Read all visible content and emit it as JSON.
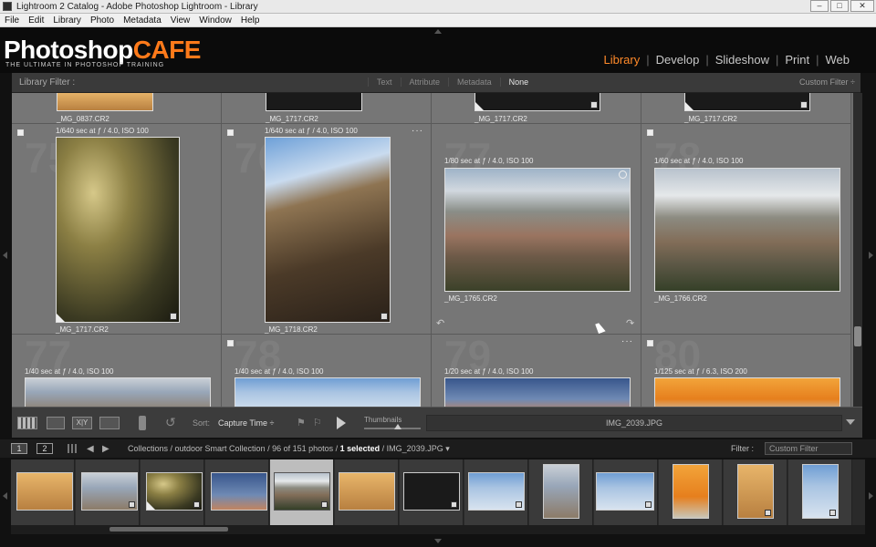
{
  "window": {
    "title": "Lightroom 2 Catalog - Adobe Photoshop Lightroom - Library",
    "controls": [
      "–",
      "□",
      "✕"
    ]
  },
  "menu": [
    "File",
    "Edit",
    "Library",
    "Photo",
    "Metadata",
    "View",
    "Window",
    "Help"
  ],
  "identity": {
    "logo_main": "Photoshop",
    "logo_accent": "CAFE",
    "tagline": "THE ULTIMATE IN PHOTOSHOP TRAINING",
    "accent_color": "#ff7a1a"
  },
  "modules": [
    {
      "label": "Library",
      "active": true
    },
    {
      "label": "Develop",
      "active": false
    },
    {
      "label": "Slideshow",
      "active": false
    },
    {
      "label": "Print",
      "active": false
    },
    {
      "label": "Web",
      "active": false
    }
  ],
  "library_filter": {
    "label": "Library Filter :",
    "options": [
      "Text",
      "Attribute",
      "Metadata",
      "None"
    ],
    "selected": "None",
    "preset": "Custom Filter ÷"
  },
  "grid": {
    "top_row": [
      {
        "filename": "_MG_0837.CR2"
      },
      {
        "filename": "_MG_1717.CR2"
      },
      {
        "filename": "_MG_1717.CR2"
      },
      {
        "filename": "_MG_1717.CR2"
      }
    ],
    "middle_row": [
      {
        "number": "75",
        "meta": "1/640 sec at ƒ / 4.0, ISO 100",
        "filename": "_MG_1717.CR2"
      },
      {
        "number": "76",
        "meta": "1/640 sec at ƒ / 4.0, ISO 100",
        "filename": "_MG_1718.CR2",
        "dots": "···"
      },
      {
        "number": "77",
        "meta": "1/80 sec at ƒ / 4.0, ISO 100",
        "filename": "_MG_1765.CR2"
      },
      {
        "number": "78",
        "meta": "1/60 sec at ƒ / 4.0, ISO 100",
        "filename": "_MG_1766.CR2"
      }
    ],
    "bottom_row": [
      {
        "number": "77",
        "meta": "1/40 sec at ƒ / 4.0, ISO 100"
      },
      {
        "number": "78",
        "meta": "1/40 sec at ƒ / 4.0, ISO 100"
      },
      {
        "number": "79",
        "meta": "1/20 sec at ƒ / 4.0, ISO 100",
        "dots": "···"
      },
      {
        "number": "80",
        "meta": "1/125 sec at ƒ / 6.3, ISO 200"
      }
    ]
  },
  "toolbar": {
    "sort_label": "Sort:",
    "sort_value": "Capture Time ÷",
    "thumbnails_label": "Thumbnails",
    "filename": "IMG_2039.JPG"
  },
  "filmstrip_header": {
    "page1": "1",
    "page2": "2",
    "path_prefix": "Collections / outdoor Smart Collection / 96 of 151 photos / ",
    "selected": "1 selected",
    "path_suffix": " / IMG_2039.JPG ▾",
    "filter_label": "Filter :",
    "filter_value": "Custom Filter"
  },
  "filmstrip": [
    {
      "style": "p-warm"
    },
    {
      "style": "p-sky1"
    },
    {
      "style": "p-tree1"
    },
    {
      "style": "p-sky3"
    },
    {
      "style": "p-canyon2",
      "selected": true
    },
    {
      "style": "p-warm"
    },
    {
      "style": "p-dark"
    },
    {
      "style": "p-sky2"
    },
    {
      "style": "p-sky1"
    },
    {
      "style": "p-sky2"
    },
    {
      "style": "p-orange"
    },
    {
      "style": "p-warm"
    },
    {
      "style": "p-sky2"
    }
  ]
}
